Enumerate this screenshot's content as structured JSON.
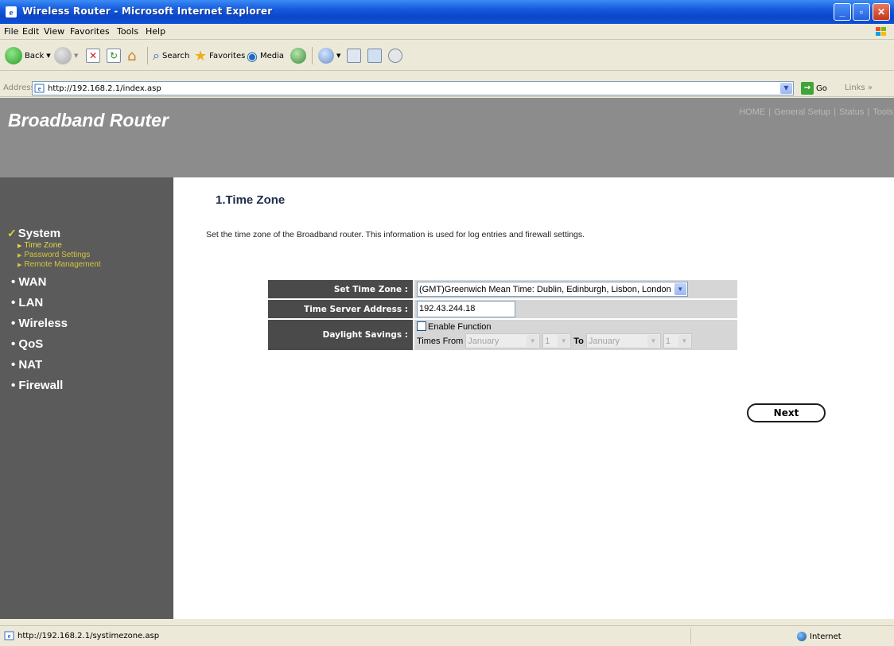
{
  "window": {
    "title": "Wireless Router - Microsoft Internet Explorer"
  },
  "menu": [
    "File",
    "Edit",
    "View",
    "Favorites",
    "Tools",
    "Help"
  ],
  "toolbar": {
    "back": "Back",
    "search": "Search",
    "favorites": "Favorites",
    "media": "Media"
  },
  "address": {
    "label": "Address",
    "url": "http://192.168.2.1/index.asp",
    "go": "Go",
    "links": "Links"
  },
  "header": {
    "brand": "Broadband Router",
    "nav": [
      "HOME",
      "General Setup",
      "Status",
      "Tools"
    ]
  },
  "sidebar": {
    "system": "System",
    "sub": [
      "Time Zone",
      "Password Settings",
      "Remote Management"
    ],
    "items": [
      "WAN",
      "LAN",
      "Wireless",
      "QoS",
      "NAT",
      "Firewall"
    ]
  },
  "content": {
    "title": "1.Time Zone",
    "description": "Set the time zone of the Broadband router. This information is used for log entries and firewall settings.",
    "set_time_zone_label": "Set Time Zone :",
    "time_zone_value": "(GMT)Greenwich Mean Time: Dublin, Edinburgh, Lisbon, London",
    "time_server_label": "Time Server Address :",
    "time_server_value": "192.43.244.18",
    "daylight_label": "Daylight Savings :",
    "enable_function": "Enable Function",
    "times_from": "Times From",
    "to": "To",
    "from_month": "January",
    "from_day": "1",
    "to_month": "January",
    "to_day": "1",
    "next": "Next"
  },
  "status": {
    "text": "http://192.168.2.1/systimezone.asp",
    "zone": "Internet"
  }
}
